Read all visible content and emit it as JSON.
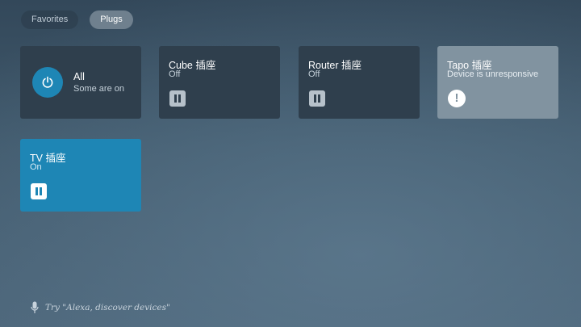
{
  "tabs": [
    {
      "label": "Favorites",
      "active": false
    },
    {
      "label": "Plugs",
      "active": true
    }
  ],
  "all_tile": {
    "icon": "power-icon",
    "name": "All",
    "status": "Some are on"
  },
  "devices": [
    {
      "name": "Cube 插座",
      "status": "Off",
      "icon": "plug-icon"
    },
    {
      "name": "Router 插座",
      "status": "Off",
      "icon": "plug-icon"
    },
    {
      "name": "Tapo 插座",
      "status": "Device is unresponsive",
      "icon": "warning-icon"
    },
    {
      "name": "TV 插座",
      "status": "On",
      "icon": "plug-icon"
    }
  ],
  "hint": {
    "icon": "microphone-icon",
    "text": "Try \"Alexa, discover devices\""
  },
  "colors": {
    "accent": "#1e86b5",
    "tile_dark": "#2f3f4d",
    "tile_unresponsive": "#8193a0"
  }
}
